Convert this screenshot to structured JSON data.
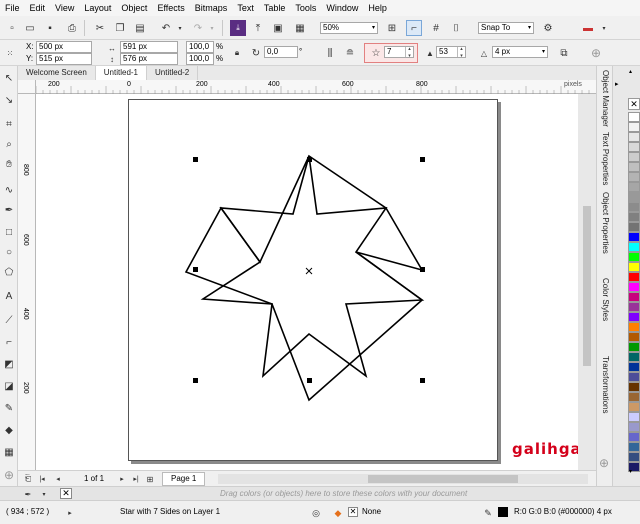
{
  "menu": [
    "File",
    "Edit",
    "View",
    "Layout",
    "Object",
    "Effects",
    "Bitmaps",
    "Text",
    "Table",
    "Tools",
    "Window",
    "Help"
  ],
  "toolbar": {
    "zoom_value": "50%",
    "snap_label": "Snap To"
  },
  "property_bar": {
    "x_label": "X:",
    "x_value": "500 px",
    "y_label": "Y:",
    "y_value": "515 px",
    "width_value": "591 px",
    "height_value": "576 px",
    "scale_w": "100,0",
    "scale_h": "100,0",
    "pct_w": "%",
    "pct_h": "%",
    "rotation_value": "0,0",
    "degree_symbol": "°",
    "points_value": "7",
    "sharpness_value": "53",
    "outline_value": "4 px"
  },
  "doc_tabs": [
    "Welcome Screen",
    "Untitled-1",
    "Untitled-2"
  ],
  "ruler": {
    "h_ticks": [
      "200",
      "0",
      "200",
      "400",
      "600",
      "800"
    ],
    "v_ticks": [
      "800",
      "600",
      "400",
      "200"
    ],
    "unit": "pixels"
  },
  "watermark": "galihgasendra",
  "page_nav": {
    "count": "1 of 1",
    "page_tab": "Page 1"
  },
  "dockers": [
    "Object Manager",
    "Text Properties",
    "Object Properties",
    "Color Styles",
    "Transformations"
  ],
  "palette_colors": [
    "#ffffff",
    "#f2f2f2",
    "#e6e6e6",
    "#d9d9d9",
    "#cccccc",
    "#bfbfbf",
    "#b3b3b3",
    "#a6a6a6",
    "#999999",
    "#8c8c8c",
    "#808080",
    "#737373",
    "#0000ff",
    "#00ffff",
    "#00ff00",
    "#ffff00",
    "#ff0000",
    "#ff00ff",
    "#c8007d",
    "#993399",
    "#7f00ff",
    "#ff8000",
    "#b25900",
    "#009900",
    "#006666",
    "#003399",
    "#4d4d99",
    "#663300",
    "#996633",
    "#cc9966",
    "#ccccff",
    "#9999cc",
    "#6666cc",
    "#336699",
    "#334d80",
    "#1a1a66"
  ],
  "colorbar": {
    "hint": "Drag colors (or objects) here to store these colors with your document"
  },
  "status": {
    "coords": "( 934 ; 572 )",
    "object_info": "Star with 7 Sides on Layer 1",
    "fill_label": "None",
    "outline_info": "R:0 G:0 B:0 (#000000)  4 px"
  },
  "colors": {
    "selected_highlight": "#f08080",
    "active_tab": "#ffffff",
    "watermark": "#d4001a"
  }
}
